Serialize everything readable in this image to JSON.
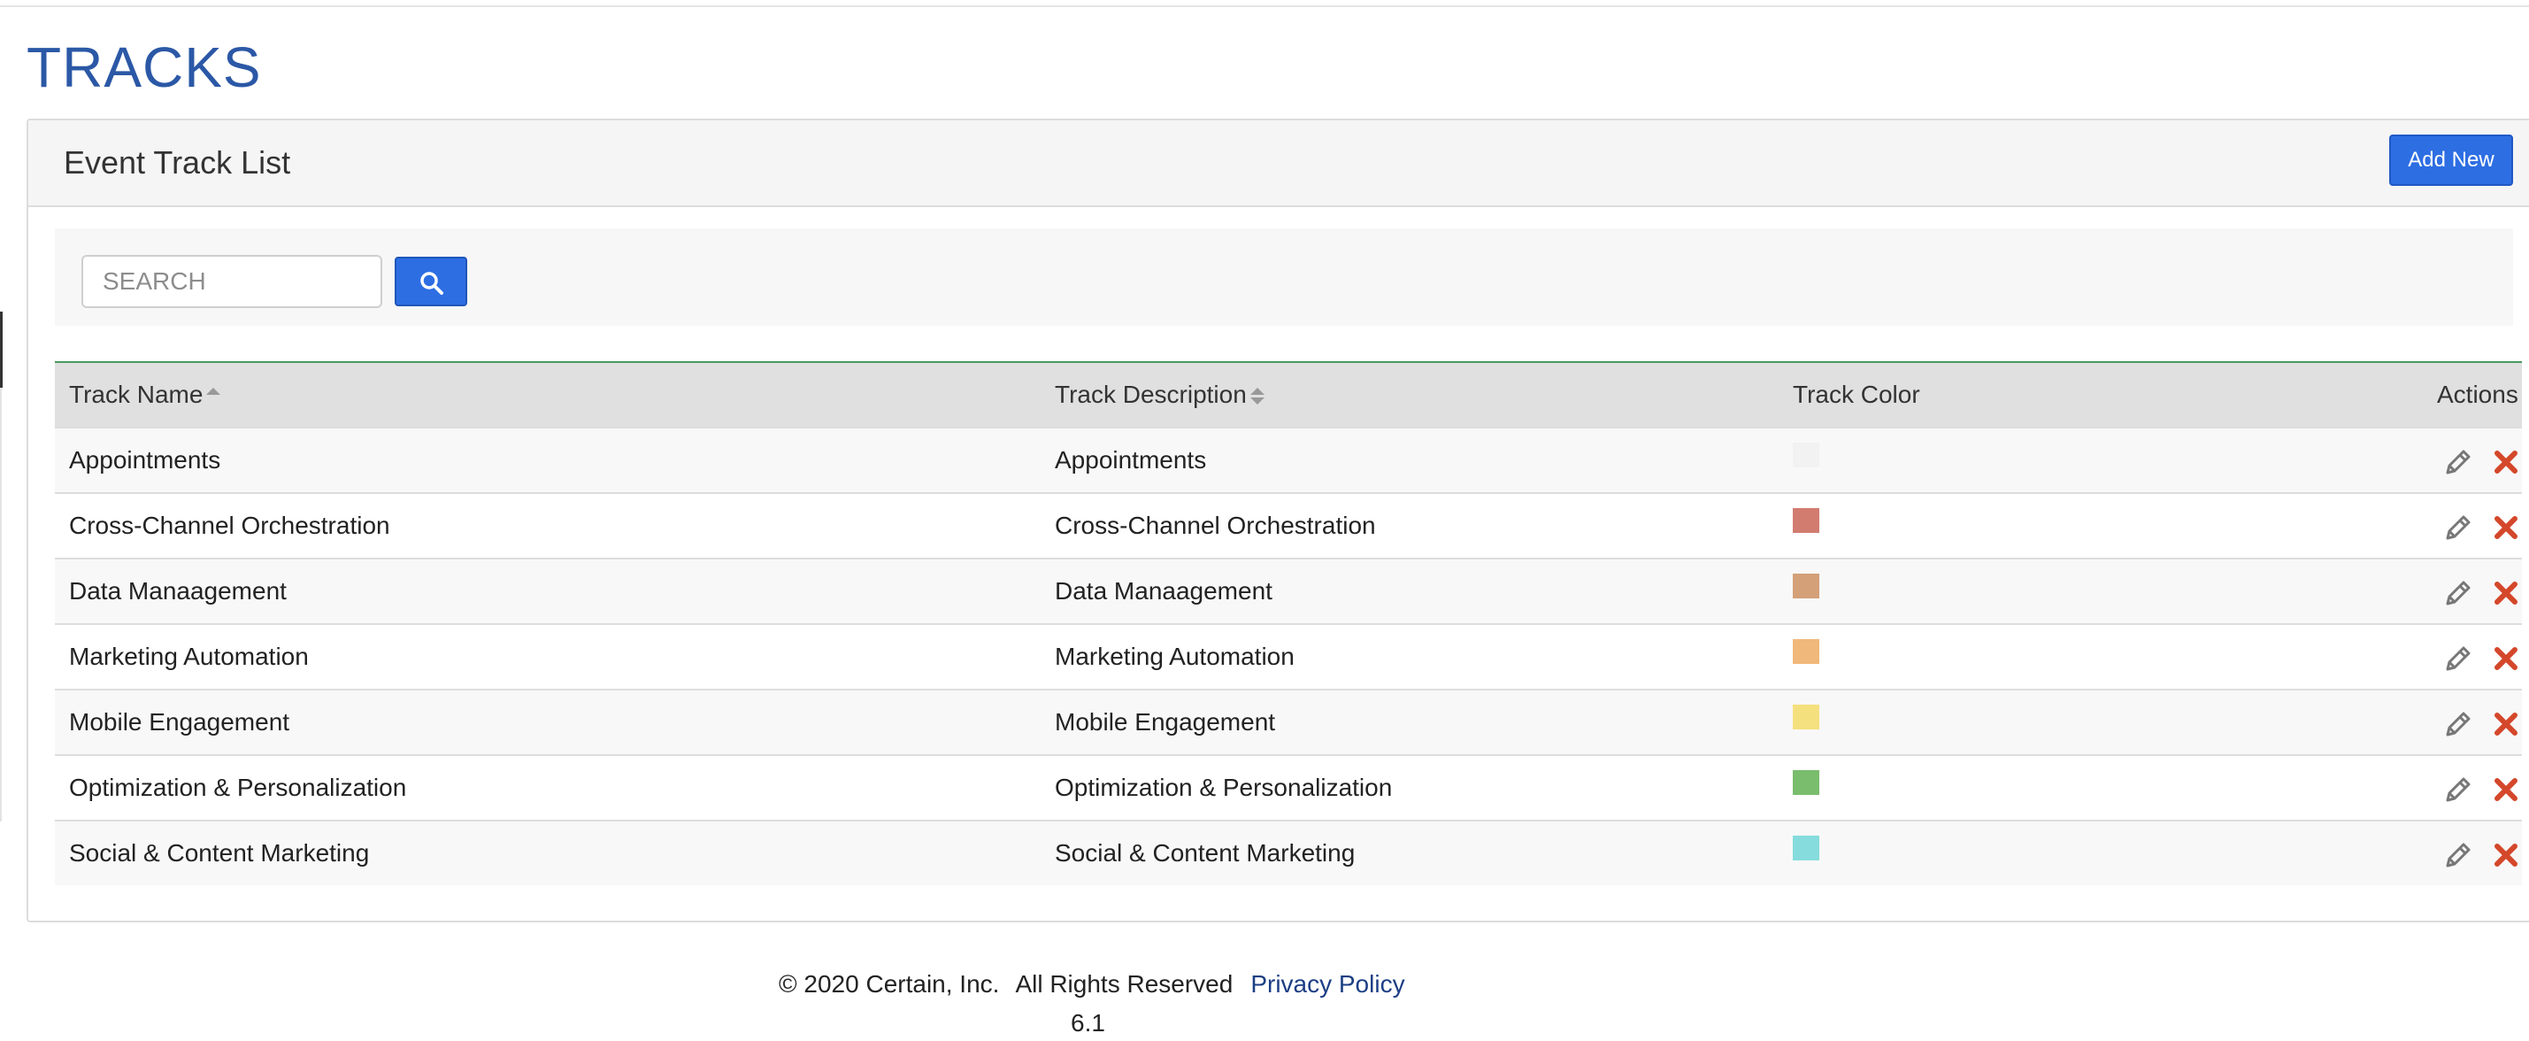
{
  "page": {
    "title": "TRACKS"
  },
  "panel": {
    "title": "Event Track List",
    "add_button_label": "Add New"
  },
  "search": {
    "placeholder": "SEARCH",
    "value": "",
    "button_icon": "search-icon"
  },
  "table": {
    "headers": {
      "name": "Track Name",
      "description": "Track Description",
      "color": "Track Color",
      "actions": "Actions"
    },
    "sort": {
      "name": "ascending",
      "description": "unsorted"
    },
    "rows": [
      {
        "name": "Appointments",
        "description": "Appointments",
        "color": "#f2f2f2"
      },
      {
        "name": "Cross-Channel Orchestration",
        "description": "Cross-Channel Orchestration",
        "color": "#d27c70"
      },
      {
        "name": "Data Manaagement",
        "description": "Data Manaagement",
        "color": "#d4a078"
      },
      {
        "name": "Marketing Automation",
        "description": "Marketing Automation",
        "color": "#f0b87a"
      },
      {
        "name": "Mobile Engagement",
        "description": "Mobile Engagement",
        "color": "#f5e07e"
      },
      {
        "name": "Optimization & Personalization",
        "description": "Optimization & Personalization",
        "color": "#79bd6d"
      },
      {
        "name": "Social & Content Marketing",
        "description": "Social & Content Marketing",
        "color": "#86dcdc"
      }
    ],
    "action_icons": {
      "edit": "pencil-icon",
      "delete": "close-icon"
    }
  },
  "footer": {
    "copyright": "© 2020 Certain, Inc.",
    "rights": "All Rights Reserved",
    "privacy_link": "Privacy Policy",
    "version": "6.1"
  },
  "colors": {
    "title": "#2b58a6",
    "primary_button": "#2d6ee3",
    "delete_icon": "#d4472a",
    "edit_icon": "#777777",
    "table_header_border": "#4a9a5e"
  }
}
